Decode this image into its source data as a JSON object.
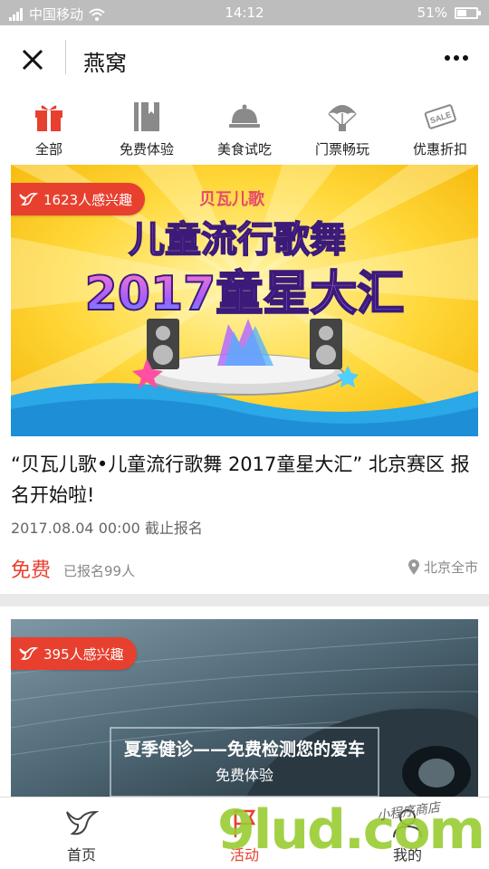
{
  "status_bar": {
    "carrier": "中国移动",
    "time": "14:12",
    "battery": "51%",
    "battery_level": 0.51
  },
  "nav": {
    "title": "燕窝"
  },
  "categories": [
    {
      "label": "全部",
      "icon": "gift-icon"
    },
    {
      "label": "免费体验",
      "icon": "book-icon"
    },
    {
      "label": "美食试吃",
      "icon": "food-cloche-icon"
    },
    {
      "label": "门票畅玩",
      "icon": "parachute-icon"
    },
    {
      "label": "优惠折扣",
      "icon": "sale-tag-icon"
    }
  ],
  "cards": [
    {
      "interest": "1623人感兴趣",
      "banner": {
        "logo": "贝瓦儿歌",
        "line1": "儿童流行歌舞",
        "line2": "2017童星大汇"
      },
      "title": "“贝瓦儿歌•儿童流行歌舞 2017童星大汇” 北京赛区 报名开始啦!",
      "date": "2017.08.04 00:00 截止报名",
      "price": "免费",
      "signed_up": "已报名99人",
      "location": "北京全市"
    },
    {
      "interest": "395人感兴趣",
      "banner": {
        "line1": "夏季健诊——免费检测您的爱车",
        "line2": "免费体验"
      }
    }
  ],
  "tabs": [
    {
      "label": "首页",
      "icon": "home-bird-icon"
    },
    {
      "label": "活动",
      "icon": "activity-flag-icon",
      "active": true
    },
    {
      "label": "我的",
      "icon": "user-icon"
    }
  ],
  "watermark": {
    "main": "9lud.com",
    "sub": "小程序商店"
  },
  "colors": {
    "accent": "#e8402f",
    "active_tab": "#e8402f"
  }
}
